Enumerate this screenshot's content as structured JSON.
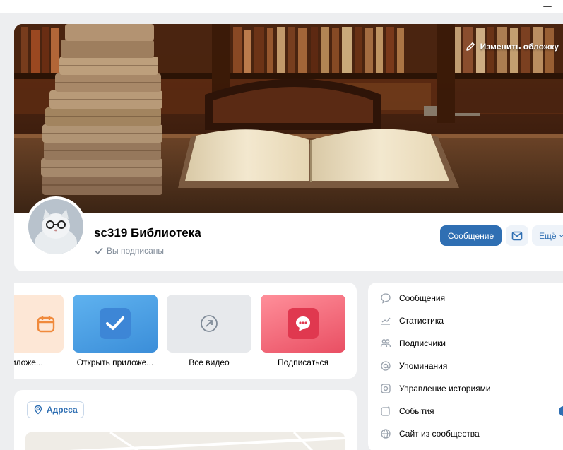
{
  "cover": {
    "edit_label": "Изменить обложку"
  },
  "group": {
    "name": "sc319 Библиотека",
    "subscribed_label": "Вы подписаны"
  },
  "actions": {
    "message_label": "Сообщение",
    "more_label": "Ещё"
  },
  "apps": [
    {
      "label": "ь приложе..."
    },
    {
      "label": "Открыть приложе..."
    },
    {
      "label": "Все видео"
    },
    {
      "label": "Подписаться"
    }
  ],
  "addresses": {
    "label": "Адреса"
  },
  "menu": [
    {
      "label": "Сообщения",
      "icon": "chat-bubble-icon"
    },
    {
      "label": "Статистика",
      "icon": "stats-icon"
    },
    {
      "label": "Подписчики",
      "icon": "users-icon"
    },
    {
      "label": "Упоминания",
      "icon": "at-icon"
    },
    {
      "label": "Управление историями",
      "icon": "stories-icon"
    },
    {
      "label": "События",
      "icon": "event-icon"
    },
    {
      "label": "Сайт из сообщества",
      "icon": "globe-icon"
    }
  ],
  "colors": {
    "accent": "#2f6fb3",
    "background": "#edeef0",
    "muted_text": "#818c99"
  }
}
